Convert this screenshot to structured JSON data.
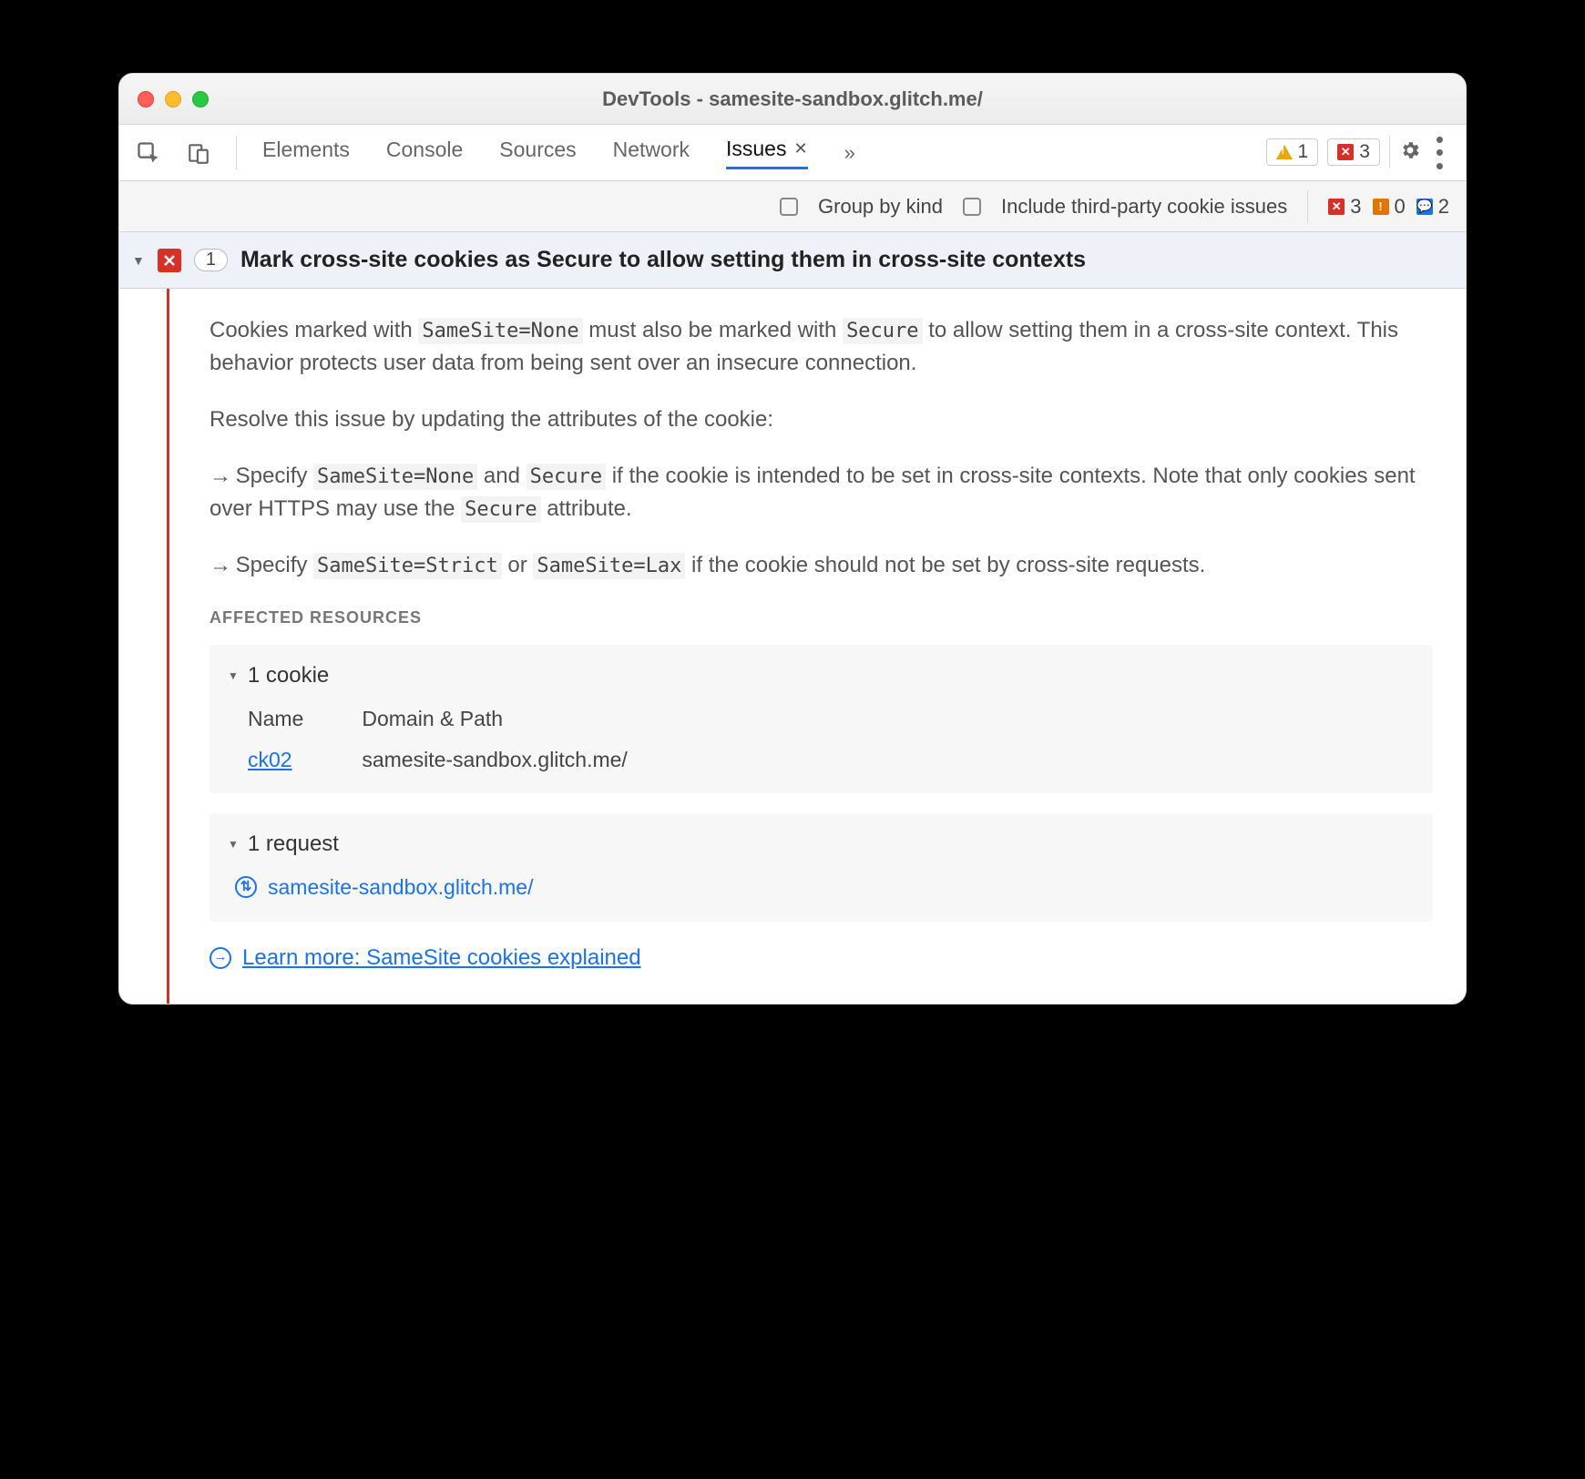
{
  "window": {
    "title": "DevTools - samesite-sandbox.glitch.me/"
  },
  "tabs": {
    "elements": "Elements",
    "console": "Console",
    "sources": "Sources",
    "network": "Network",
    "issues": "Issues"
  },
  "topCounts": {
    "warnings": "1",
    "errors": "3"
  },
  "filters": {
    "groupByKind": "Group by kind",
    "thirdParty": "Include third-party cookie issues"
  },
  "filterCounts": {
    "errors": "3",
    "warnings": "0",
    "info": "2"
  },
  "issue": {
    "count": "1",
    "title": "Mark cross-site cookies as Secure to allow setting them in cross-site contexts",
    "para1a": "Cookies marked with ",
    "code1": "SameSite=None",
    "para1b": " must also be marked with ",
    "code2": "Secure",
    "para1c": " to allow setting them in a cross-site context. This behavior protects user data from being sent over an insecure connection.",
    "para2": "Resolve this issue by updating the attributes of the cookie:",
    "b1a": "Specify ",
    "b1c1": "SameSite=None",
    "b1b": " and ",
    "b1c2": "Secure",
    "b1c": " if the cookie is intended to be set in cross-site contexts. Note that only cookies sent over HTTPS may use the ",
    "b1c3": "Secure",
    "b1d": " attribute.",
    "b2a": "Specify ",
    "b2c1": "SameSite=Strict",
    "b2b": " or ",
    "b2c2": "SameSite=Lax",
    "b2c": " if the cookie should not be set by cross-site requests.",
    "affectedLabel": "AFFECTED RESOURCES",
    "cookieHeader": "1 cookie",
    "colName": "Name",
    "colDomain": "Domain & Path",
    "cookieName": "ck02",
    "cookieDomain": "samesite-sandbox.glitch.me/",
    "requestHeader": "1 request",
    "requestUrl": "samesite-sandbox.glitch.me/",
    "learnMore": "Learn more: SameSite cookies explained"
  }
}
